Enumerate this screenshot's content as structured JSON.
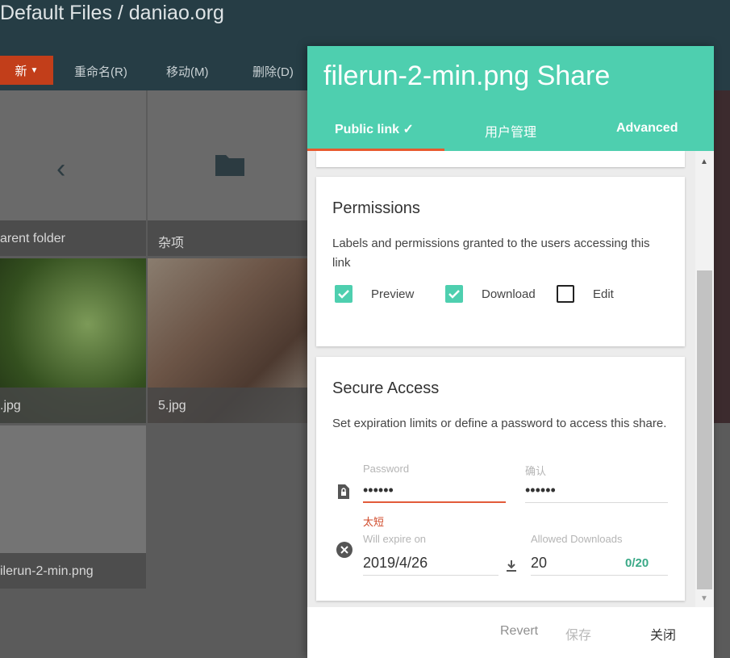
{
  "app": {
    "title": "Default Files / daniao.org"
  },
  "toolbar": {
    "new_label": "新",
    "rename_label": "重命名(R)",
    "move_label": "移动(M)",
    "delete_label": "删除(D)"
  },
  "files": [
    {
      "name": "arent folder"
    },
    {
      "name": "杂项"
    },
    {
      "name": ".jpg"
    },
    {
      "name": "5.jpg"
    },
    {
      "name": "ilerun-2-min.png"
    }
  ],
  "modal": {
    "title": "filerun-2-min.png Share",
    "tabs": [
      {
        "label": "Public link ✓"
      },
      {
        "label": "用户管理"
      },
      {
        "label": "Advanced"
      }
    ],
    "permissions": {
      "title": "Permissions",
      "description": "Labels and permissions granted to the users accessing this link",
      "options": [
        {
          "label": "Preview",
          "checked": true
        },
        {
          "label": "Download",
          "checked": true
        },
        {
          "label": "Edit",
          "checked": false
        }
      ]
    },
    "secure": {
      "title": "Secure Access",
      "description": "Set expiration limits or define a password to access this share.",
      "password_label": "Password",
      "password_value": "••••••",
      "confirm_label": "确认",
      "confirm_value": "••••••",
      "error": "太短",
      "expire_label": "Will expire on",
      "expire_value": "2019/4/26",
      "downloads_label": "Allowed Downloads",
      "downloads_value": "20",
      "downloads_counter": "0/20"
    },
    "footer": {
      "revert": "Revert",
      "save": "保存",
      "close": "关闭"
    }
  },
  "colors": {
    "accent": "#4ecfaf",
    "header_bg": "#263d45",
    "new_button": "#c23e1a",
    "error": "#e25b3a"
  }
}
